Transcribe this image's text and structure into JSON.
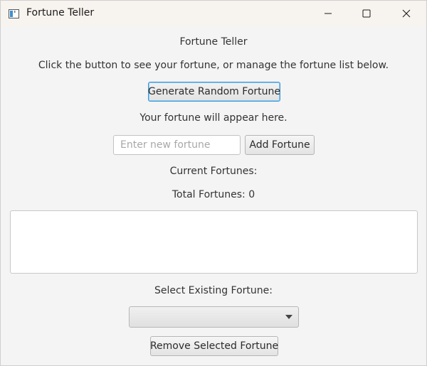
{
  "window": {
    "title": "Fortune Teller"
  },
  "header": {
    "app_title": "Fortune Teller",
    "instructions": "Click the button to see your fortune, or manage the fortune list below."
  },
  "fortune": {
    "generate_label": "Generate Random Fortune",
    "result_text": "Your fortune will appear here."
  },
  "add": {
    "placeholder": "Enter new fortune",
    "value": "",
    "button_label": "Add Fortune"
  },
  "list": {
    "heading": "Current Fortunes:",
    "total_text": "Total Fortunes: 0",
    "items": []
  },
  "select": {
    "heading": "Select Existing Fortune:",
    "selected_value": "",
    "options": []
  },
  "remove": {
    "button_label": "Remove Selected Fortune"
  },
  "colors": {
    "background": "#f4f4f4",
    "titlebar": "#f7f3ee",
    "focus_accent": "#3a9ad9"
  },
  "icons": {
    "app": "app-window-icon",
    "minimize": "minimize-icon",
    "maximize": "maximize-icon",
    "close": "close-icon",
    "dropdown": "chevron-down-icon"
  }
}
